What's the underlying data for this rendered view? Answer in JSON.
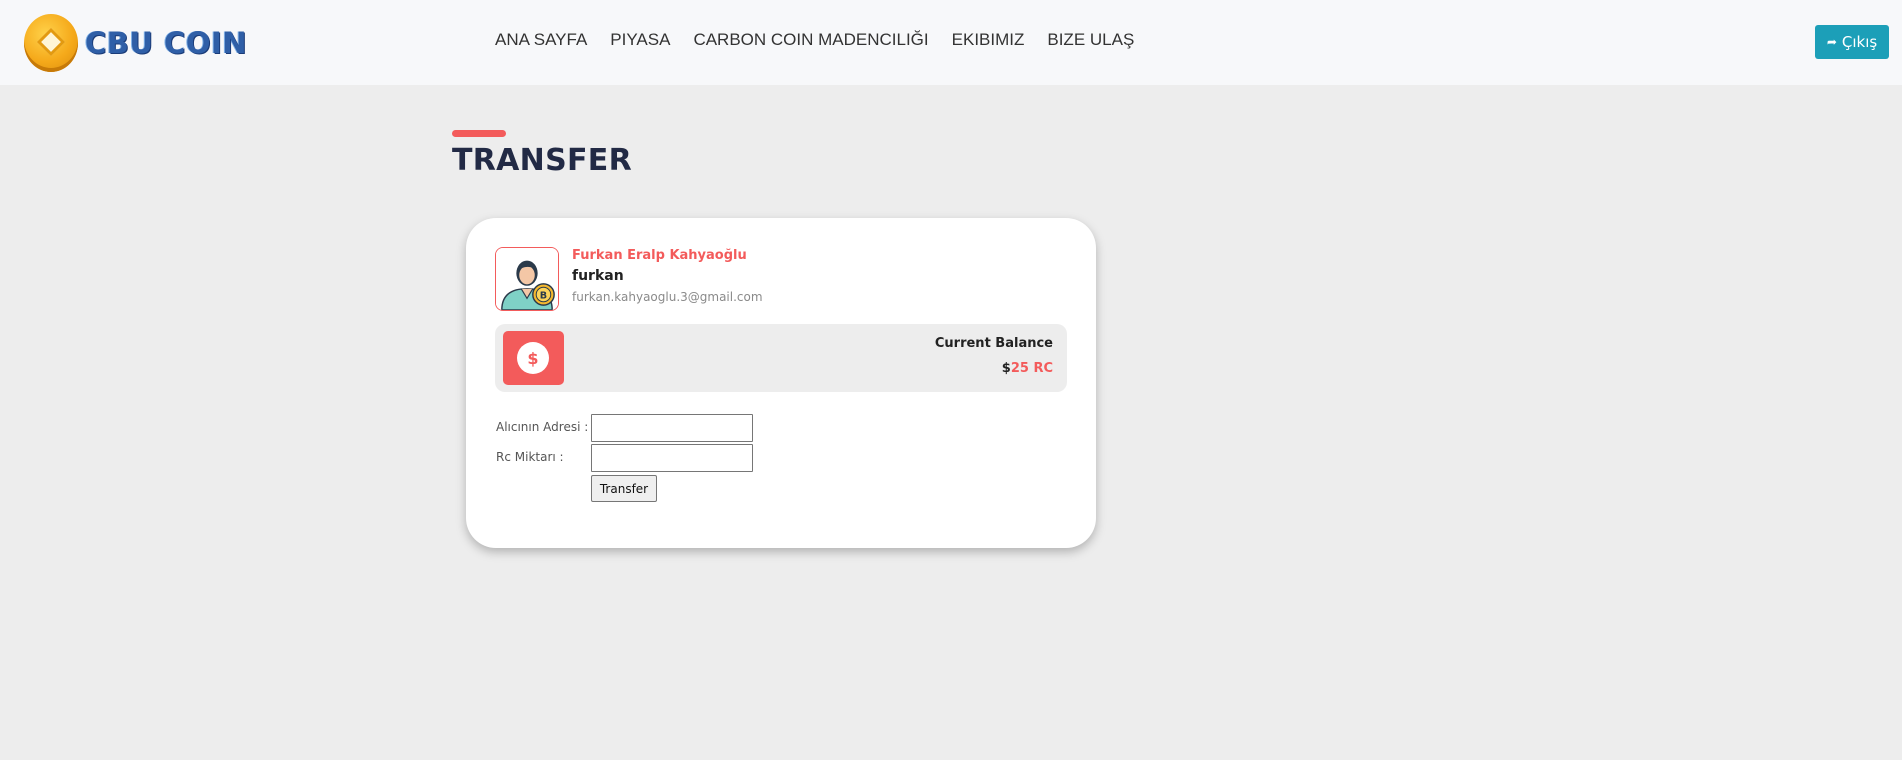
{
  "brand": {
    "name": "CBU COIN"
  },
  "nav": {
    "items": [
      {
        "label": "ANA SAYFA"
      },
      {
        "label": "PIYASA"
      },
      {
        "label": "CARBON COIN MADENCILIĞI"
      },
      {
        "label": "EKIBIMIZ"
      },
      {
        "label": "BIZE ULAŞ"
      }
    ],
    "logout_label": "Çıkış",
    "logout_icon": "sign-out-icon"
  },
  "page": {
    "title": "TRANSFER"
  },
  "user": {
    "full_name": "Furkan Eralp Kahyaoğlu",
    "username": "furkan",
    "email": "furkan.kahyaoglu.3@gmail.com",
    "avatar_icon": "user-bitcoin-avatar-icon"
  },
  "balance": {
    "label": "Current Balance",
    "currency_symbol": "$",
    "amount": "25 RC",
    "icon_glyph": "$"
  },
  "form": {
    "address_label": "Alıcının Adresi :",
    "address_value": "",
    "amount_label": "Rc Miktarı :",
    "amount_value": "",
    "submit_label": "Transfer"
  },
  "colors": {
    "accent": "#f35b5b",
    "logout": "#1c9fb8",
    "title": "#222a45",
    "background": "#ededed"
  }
}
